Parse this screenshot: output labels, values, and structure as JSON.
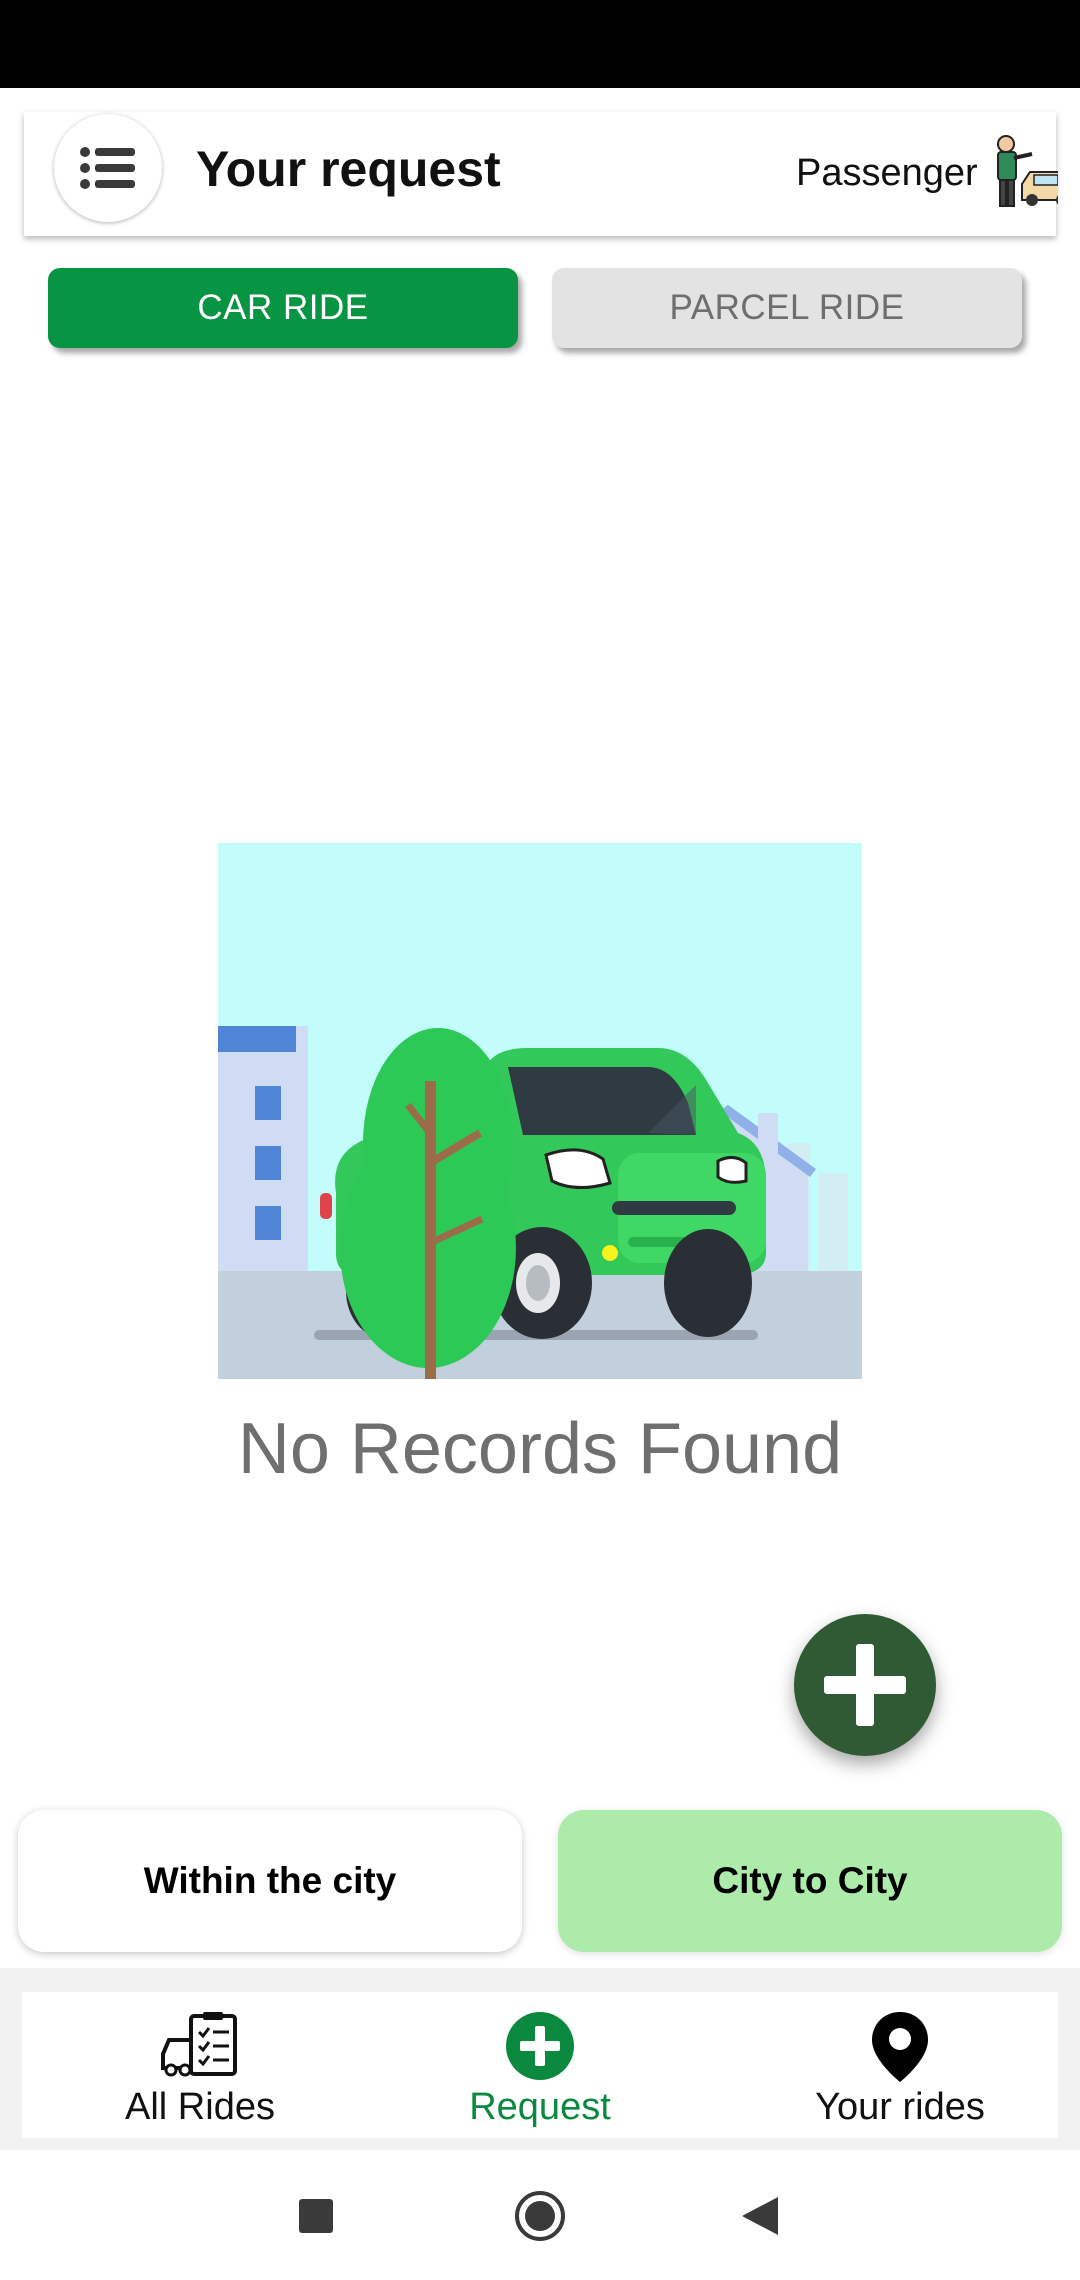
{
  "header": {
    "title": "Your request",
    "role": "Passenger",
    "menu_icon": "list-icon",
    "role_icon": "passenger-car-icon"
  },
  "tabs": [
    {
      "label": "CAR RIDE",
      "active": true
    },
    {
      "label": "PARCEL RIDE",
      "active": false
    }
  ],
  "empty_state": {
    "message": "No Records Found",
    "illustration": "green-car-illustration"
  },
  "fab": {
    "icon": "plus-icon"
  },
  "trip_types": [
    {
      "label": "Within the city",
      "selected": false
    },
    {
      "label": "City to City",
      "selected": true
    }
  ],
  "bottom_nav": [
    {
      "label": "All Rides",
      "icon": "rides-list-icon",
      "active": false
    },
    {
      "label": "Request",
      "icon": "add-circle-icon",
      "active": true
    },
    {
      "label": "Your rides",
      "icon": "location-pin-icon",
      "active": false
    }
  ],
  "colors": {
    "primary_green": "#079443",
    "fab_green": "#2f5a33",
    "selected_trip_bg": "#acebaa",
    "active_nav_label": "#0b8a3f"
  }
}
